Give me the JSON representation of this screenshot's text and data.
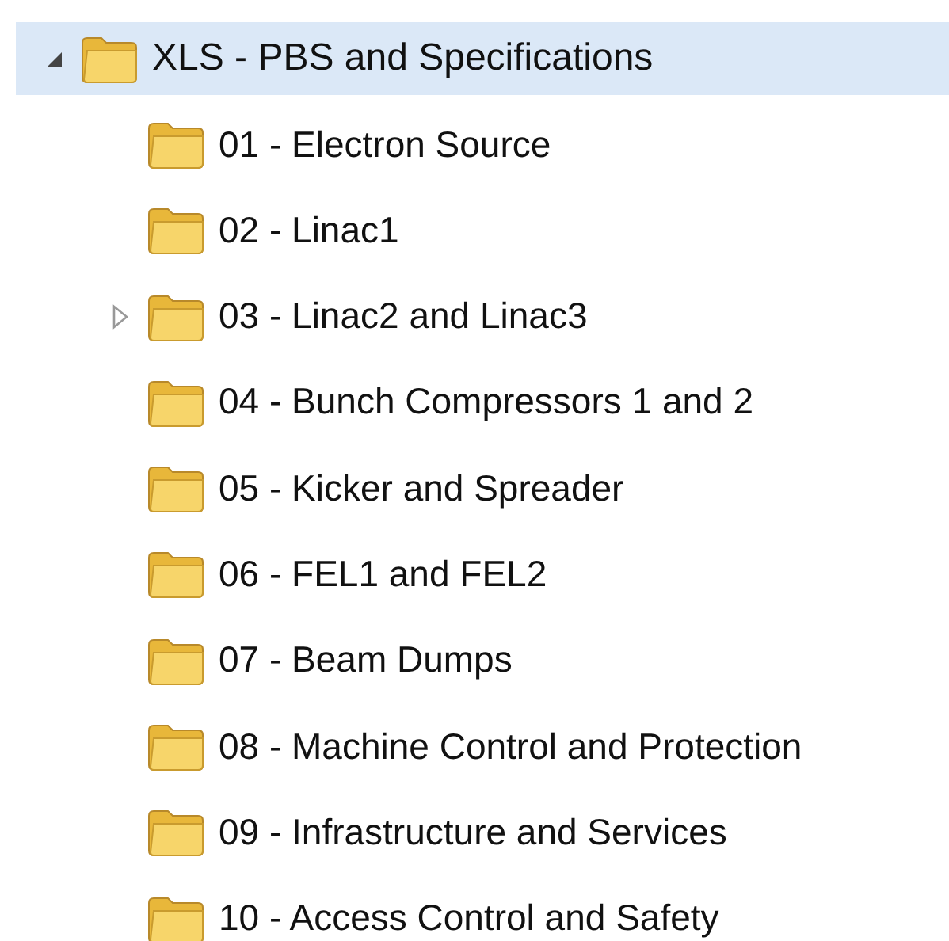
{
  "tree": {
    "label": "XLS - PBS and Specifications",
    "selected": true,
    "expanded": true,
    "children": [
      {
        "label": "01 - Electron Source",
        "selected": false
      },
      {
        "label": "02 - Linac1",
        "selected": false
      },
      {
        "label": "03 - Linac2 and Linac3",
        "selected": false,
        "expanded": false
      },
      {
        "label": "04 - Bunch Compressors 1 and 2",
        "selected": false
      },
      {
        "label": "05 - Kicker and Spreader",
        "selected": false
      },
      {
        "label": "06 - FEL1 and FEL2",
        "selected": false
      },
      {
        "label": "07 - Beam Dumps",
        "selected": false
      },
      {
        "label": "08 - Machine Control and Protection",
        "selected": false
      },
      {
        "label": "09 - Infrastructure and Services",
        "selected": false
      },
      {
        "label": "10 - Access Control and Safety",
        "selected": false
      }
    ]
  }
}
